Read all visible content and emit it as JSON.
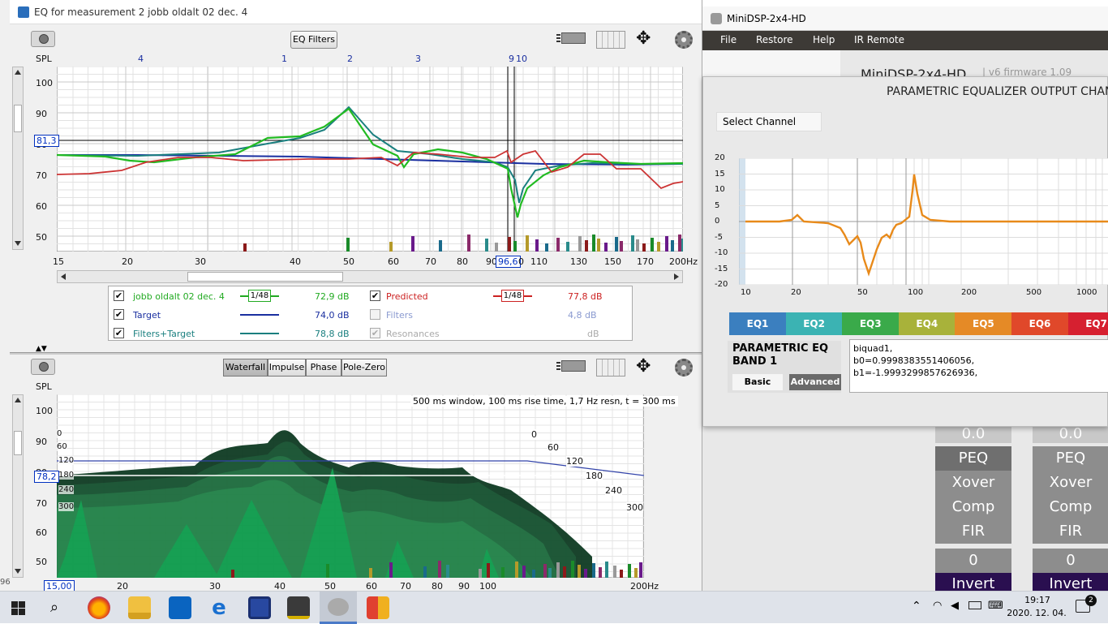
{
  "rew": {
    "title": "EQ for measurement 2 jobb oldalt 02 dec. 4",
    "eq_filters_label": "EQ Filters",
    "top_chart": {
      "ylabel": "SPL",
      "y_ticks": [
        "100",
        "90",
        "80",
        "70",
        "60",
        "50"
      ],
      "x_ticks": [
        "15",
        "20",
        "30",
        "40",
        "50",
        "60",
        "70",
        "80",
        "90",
        "110",
        "130",
        "150",
        "170",
        "200Hz"
      ],
      "top_ticks": [
        "4",
        "1",
        "2",
        "3",
        "9",
        "10"
      ],
      "cursor_y": "81,3",
      "cursor_x": "96,6",
      "x_zero": "0"
    },
    "legend": [
      {
        "label": "jobb oldalt 02 dec. 4",
        "value": "72,9 dB",
        "color": "#22aa22",
        "checked": true,
        "smoothing": "1/48"
      },
      {
        "label": "Target",
        "value": "74,0 dB",
        "color": "#1a2fa0",
        "checked": true
      },
      {
        "label": "Filters+Target",
        "value": "78,8 dB",
        "color": "#1a7f7f",
        "checked": true
      },
      {
        "label": "Predicted",
        "value": "77,8 dB",
        "color": "#cc2222",
        "checked": true,
        "smoothing": "1/48"
      },
      {
        "label": "Filters",
        "value": "4,8 dB",
        "color": "#8a9ad0",
        "checked": false
      },
      {
        "label": "Resonances",
        "value": "dB",
        "color": "#aaaaaa",
        "checked": true
      }
    ],
    "tabs": [
      "Waterfall",
      "Impulse",
      "Phase",
      "Pole-Zero"
    ],
    "waterfall": {
      "ylabel": "SPL",
      "info": "500 ms window, 100 ms rise time,  1,7 Hz resn, t = 300 ms",
      "y_ticks": [
        "100",
        "90",
        "80",
        "70",
        "60",
        "50"
      ],
      "x_ticks": [
        "20",
        "30",
        "40",
        "50",
        "60",
        "70",
        "80",
        "90",
        "100",
        "200Hz"
      ],
      "cursor_y": "78,2",
      "cursor_x": "15,00",
      "time_labels_left": [
        "0",
        "60",
        "120",
        "180",
        "240",
        "300"
      ],
      "time_labels_right": [
        "0",
        "60",
        "120",
        "180",
        "240",
        "300"
      ]
    },
    "side_number": "96"
  },
  "minidsp": {
    "title": "MiniDSP-2x4-HD",
    "menu": [
      "File",
      "Restore",
      "Help",
      "IR Remote"
    ],
    "header_partial": "MiniDSP-2x4-HD",
    "firmware_partial": "| v6 firmware 1.09",
    "panel_title": "PARAMETRIC EQUALIZER OUTPUT CHAN",
    "select_channel": "Select Channel",
    "y_ticks": [
      "20",
      "15",
      "10",
      "5",
      "0",
      "-5",
      "-10",
      "-15",
      "-20"
    ],
    "x_ticks": [
      "10",
      "20",
      "50",
      "100",
      "200",
      "500",
      "1000"
    ],
    "eq_tabs": [
      {
        "label": "EQ1",
        "color": "#3b7fbf"
      },
      {
        "label": "EQ2",
        "color": "#3bb3b3"
      },
      {
        "label": "EQ3",
        "color": "#3aaa4a"
      },
      {
        "label": "EQ4",
        "color": "#a8b23a"
      },
      {
        "label": "EQ5",
        "color": "#e58a26"
      },
      {
        "label": "EQ6",
        "color": "#e0482a"
      },
      {
        "label": "EQ7",
        "color": "#d62030"
      }
    ],
    "band_title_1": "PARAMETRIC EQ",
    "band_title_2": "BAND 1",
    "basic_label": "Basic",
    "advanced_label": "Advanced",
    "biquad_lines": [
      "biquad1,",
      "b0=0.9998383551406056,",
      "b1=-1.9993299857626936,"
    ],
    "tile_top_left": "0.0",
    "tile_top_right": "0.0",
    "tiles": [
      "PEQ",
      "Xover",
      "Comp",
      "FIR"
    ],
    "zero_left": "0",
    "zero_right": "0",
    "invert": "Invert"
  },
  "taskbar": {
    "time": "19:17",
    "date": "2020. 12. 04.",
    "notifications": "2"
  }
}
